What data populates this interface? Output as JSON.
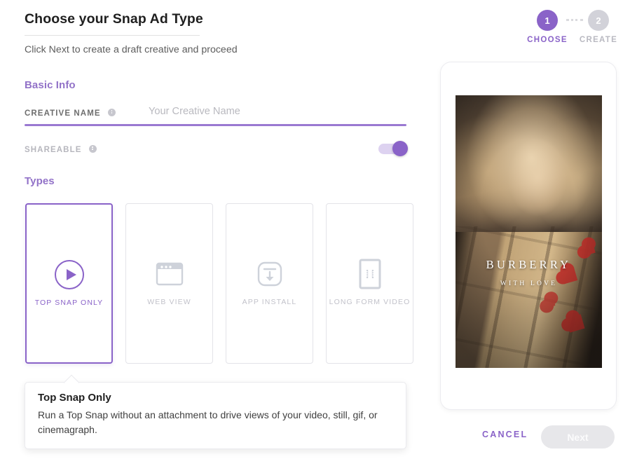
{
  "header": {
    "title": "Choose your Snap Ad Type",
    "subtitle": "Click Next to create a draft creative and proceed"
  },
  "stepper": {
    "steps": [
      {
        "number": "1",
        "label": "CHOOSE",
        "state": "active"
      },
      {
        "number": "2",
        "label": "CREATE",
        "state": "inactive"
      }
    ]
  },
  "basic_info": {
    "heading": "Basic Info",
    "creative_name": {
      "label": "CREATIVE NAME",
      "placeholder": "Your Creative Name",
      "value": ""
    },
    "shareable": {
      "label": "SHAREABLE",
      "state": "on"
    }
  },
  "types": {
    "heading": "Types",
    "cards": [
      {
        "label": "TOP SNAP ONLY",
        "icon": "play-circle-icon",
        "selected": true
      },
      {
        "label": "WEB VIEW",
        "icon": "browser-window-icon",
        "selected": false
      },
      {
        "label": "APP INSTALL",
        "icon": "download-box-icon",
        "selected": false
      },
      {
        "label": "LONG FORM VIDEO",
        "icon": "phone-film-icon",
        "selected": false
      }
    ]
  },
  "tooltip": {
    "title": "Top Snap Only",
    "description": "Run a Top Snap without an attachment to drive views of your video, still, gif, or cinemagraph."
  },
  "preview": {
    "brand": "BURBERRY",
    "tagline": "WITH LOVE"
  },
  "footer": {
    "cancel_label": "CANCEL",
    "next_label": "Next",
    "next_enabled": false
  },
  "colors": {
    "accent_purple": "#8a63c8",
    "heading_purple": "#9272c8",
    "underline_purple": "#9a79d1",
    "muted_gray": "#c2c2ca",
    "disabled_gray": "#e7e7ea"
  }
}
